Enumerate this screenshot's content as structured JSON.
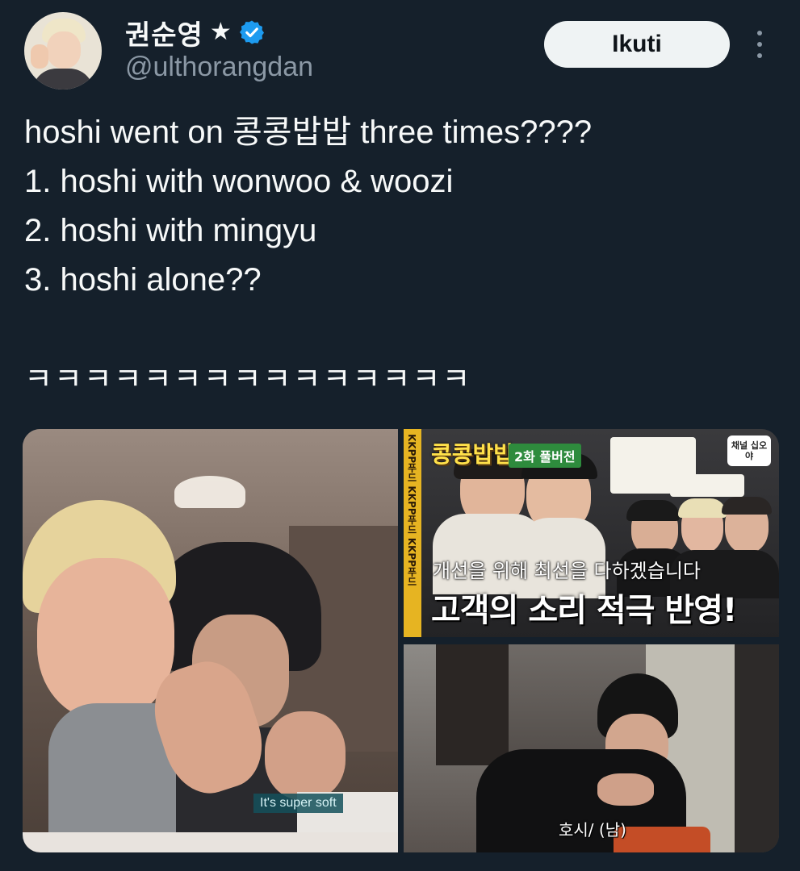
{
  "user": {
    "display_name": "권순영",
    "badge_icons": [
      "star-icon",
      "verified-icon"
    ],
    "handle": "@ulthorangdan"
  },
  "actions": {
    "follow_label": "Ikuti",
    "more_icon": "more-icon"
  },
  "tweet": {
    "lines": [
      "hoshi went on 콩콩밥밥 three times????",
      "1. hoshi with wonwoo & woozi",
      "2. hoshi with mingyu",
      "3. hoshi alone??",
      "",
      "ㅋㅋㅋㅋㅋㅋㅋㅋㅋㅋㅋㅋㅋㅋㅋ"
    ]
  },
  "media": {
    "left": {
      "caption": "It's super soft"
    },
    "top_right": {
      "show_title": "콩콩밥밥",
      "episode_badge": "2화 풀버전",
      "side_strip": "KKPP푸드 KKPP푸드 KKPP푸드",
      "corner_logo": "채널 십오야",
      "subtitle_top": "개선을 위해 최선을 다하겠습니다",
      "subtitle_main": "고객의 소리 적극 반영!"
    },
    "bottom_right": {
      "caption": "호시/ (남)"
    }
  },
  "colors": {
    "background": "#15202b",
    "text_primary": "#f7f9f9",
    "text_secondary": "#8b98a5",
    "verified_blue": "#1d9bf0",
    "follow_bg": "#eff3f4"
  }
}
